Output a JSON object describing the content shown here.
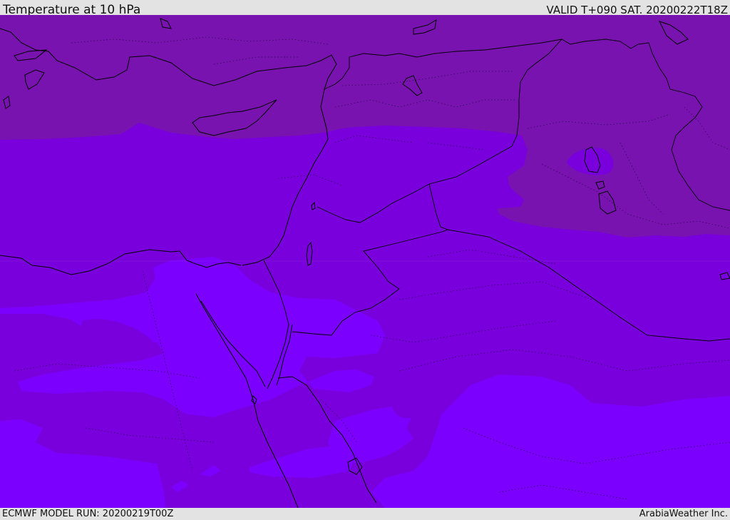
{
  "header": {
    "title": "Temperature at 10 hPa",
    "valid": "VALID T+090 SAT. 20200222T18Z"
  },
  "footer": {
    "model_run": "ECMWF MODEL RUN: 20200219T00Z",
    "brand": "ArabiaWeather Inc."
  },
  "map": {
    "field": "Temperature at 10 hPa",
    "colors": {
      "band_dark": "#7813b0",
      "band_mid": "#7900dc",
      "band_light": "#7b00fe",
      "coastline": "#000000"
    }
  }
}
